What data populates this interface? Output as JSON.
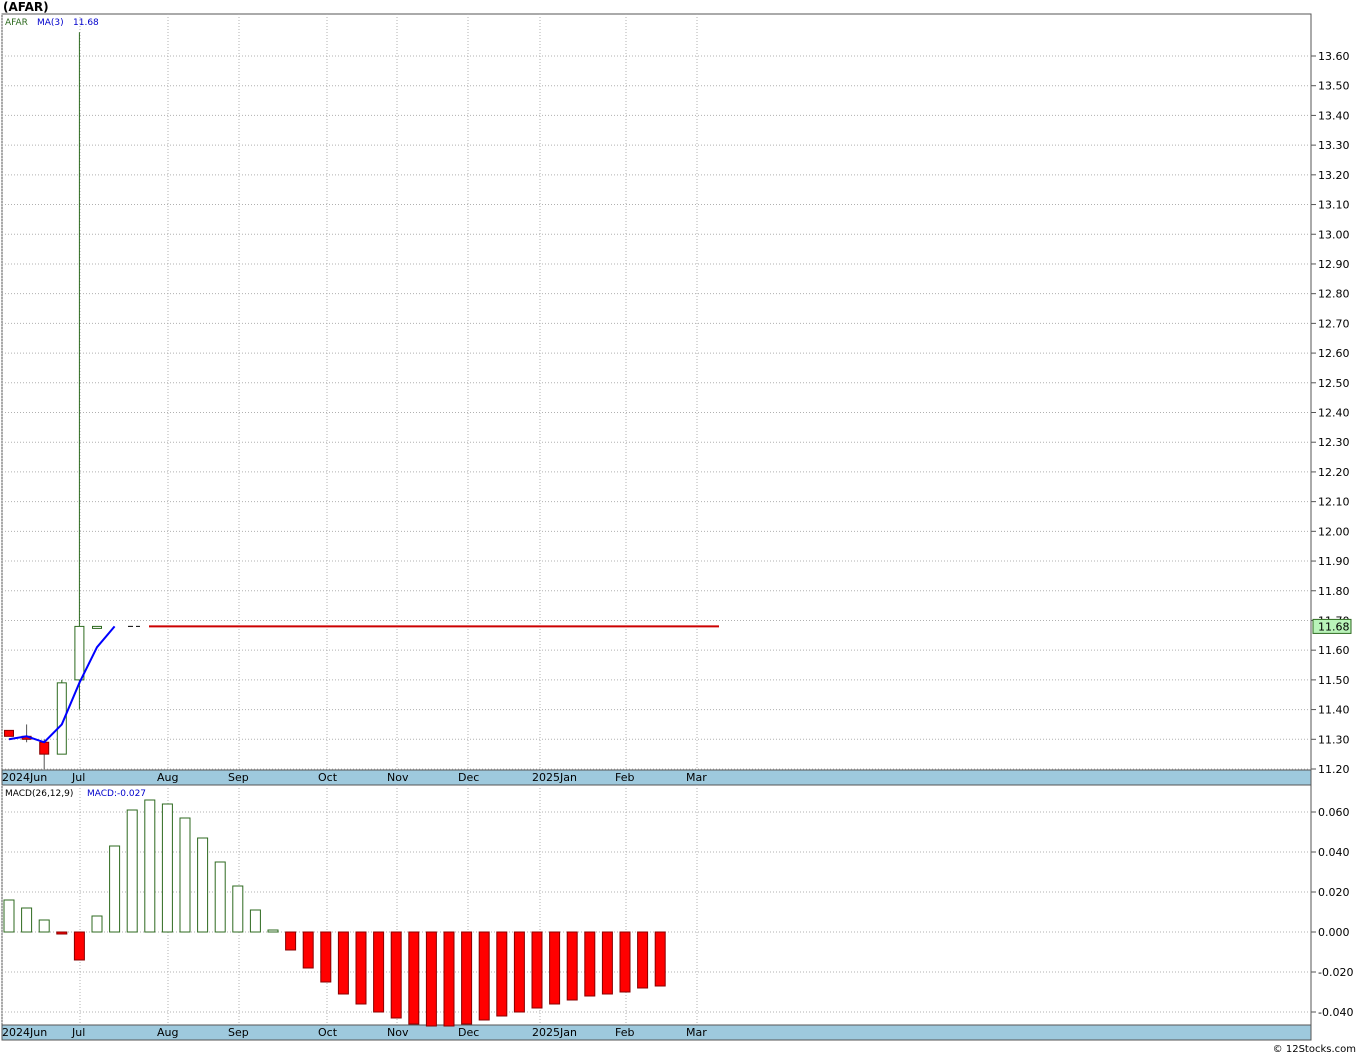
{
  "page_title": "(AFAR)",
  "footer": "© 12Stocks.com",
  "colors": {
    "up_candle": "#2d6a1f",
    "down_candle": "#ff0000",
    "ma_line": "#0000ff",
    "last_price_line": "#cc0000",
    "grid": "#b0b0b0",
    "axis_band": "#9ec9dd",
    "price_badge": "#b9f3b9"
  },
  "chart_data": [
    {
      "type": "candlestick",
      "legend": {
        "symbol": "AFAR",
        "ma_label": "MA(3)",
        "ma_value": "11.68"
      },
      "ylim": [
        11.18,
        13.72
      ],
      "y_ticks": [
        "11.20",
        "11.30",
        "11.40",
        "11.50",
        "11.60",
        "11.70",
        "11.80",
        "11.90",
        "12.00",
        "12.10",
        "12.20",
        "12.30",
        "12.40",
        "12.50",
        "12.60",
        "12.70",
        "12.80",
        "12.90",
        "13.00",
        "13.10",
        "13.20",
        "13.30",
        "13.40",
        "13.50",
        "13.60"
      ],
      "x_labels": [
        "2024Jun",
        "Jul",
        "Aug",
        "Sep",
        "Oct",
        "Nov",
        "Dec",
        "2025Jan",
        "Feb",
        "Mar"
      ],
      "last_price": "11.68",
      "candles": [
        {
          "week": "2024-06-21",
          "open": 11.33,
          "high": 11.33,
          "low": 11.31,
          "close": 11.31
        },
        {
          "week": "2024-06-28",
          "open": 11.31,
          "high": 11.35,
          "low": 11.29,
          "close": 11.3
        },
        {
          "week": "2024-07-05",
          "open": 11.29,
          "high": 11.3,
          "low": 11.2,
          "close": 11.25
        },
        {
          "week": "2024-07-12",
          "open": 11.25,
          "high": 11.5,
          "low": 11.25,
          "close": 11.49
        },
        {
          "week": "2024-07-19",
          "open": 11.5,
          "high": 13.68,
          "low": 11.4,
          "close": 11.68
        },
        {
          "week": "2024-07-26",
          "open": 11.68,
          "high": 11.68,
          "low": 11.68,
          "close": 11.68
        }
      ],
      "ma3": [
        {
          "week": "2024-06-21",
          "value": 11.3
        },
        {
          "week": "2024-06-28",
          "value": 11.31
        },
        {
          "week": "2024-07-05",
          "value": 11.29
        },
        {
          "week": "2024-07-12",
          "value": 11.35
        },
        {
          "week": "2024-07-19",
          "value": 11.49
        },
        {
          "week": "2024-07-26",
          "value": 11.61
        },
        {
          "week": "2024-08-02",
          "value": 11.68
        }
      ]
    },
    {
      "type": "bar",
      "legend": {
        "label": "MACD(26,12,9)",
        "value_label": "MACD:-0.027"
      },
      "ylim": [
        -0.047,
        0.069
      ],
      "y_ticks": [
        "0.060",
        "0.040",
        "0.020",
        "0.000",
        "-0.020",
        "-0.040"
      ],
      "x_labels": [
        "2024Jun",
        "Jul",
        "Aug",
        "Sep",
        "Oct",
        "Nov",
        "Dec",
        "2025Jan",
        "Feb",
        "Mar"
      ],
      "values": [
        0.016,
        0.012,
        0.006,
        -0.001,
        -0.014,
        0.008,
        0.043,
        0.061,
        0.066,
        0.064,
        0.057,
        0.047,
        0.035,
        0.023,
        0.011,
        0.001,
        -0.009,
        -0.018,
        -0.025,
        -0.031,
        -0.036,
        -0.04,
        -0.043,
        -0.046,
        -0.047,
        -0.047,
        -0.046,
        -0.044,
        -0.042,
        -0.04,
        -0.038,
        -0.036,
        -0.034,
        -0.032,
        -0.031,
        -0.03,
        -0.028,
        -0.027
      ]
    }
  ]
}
